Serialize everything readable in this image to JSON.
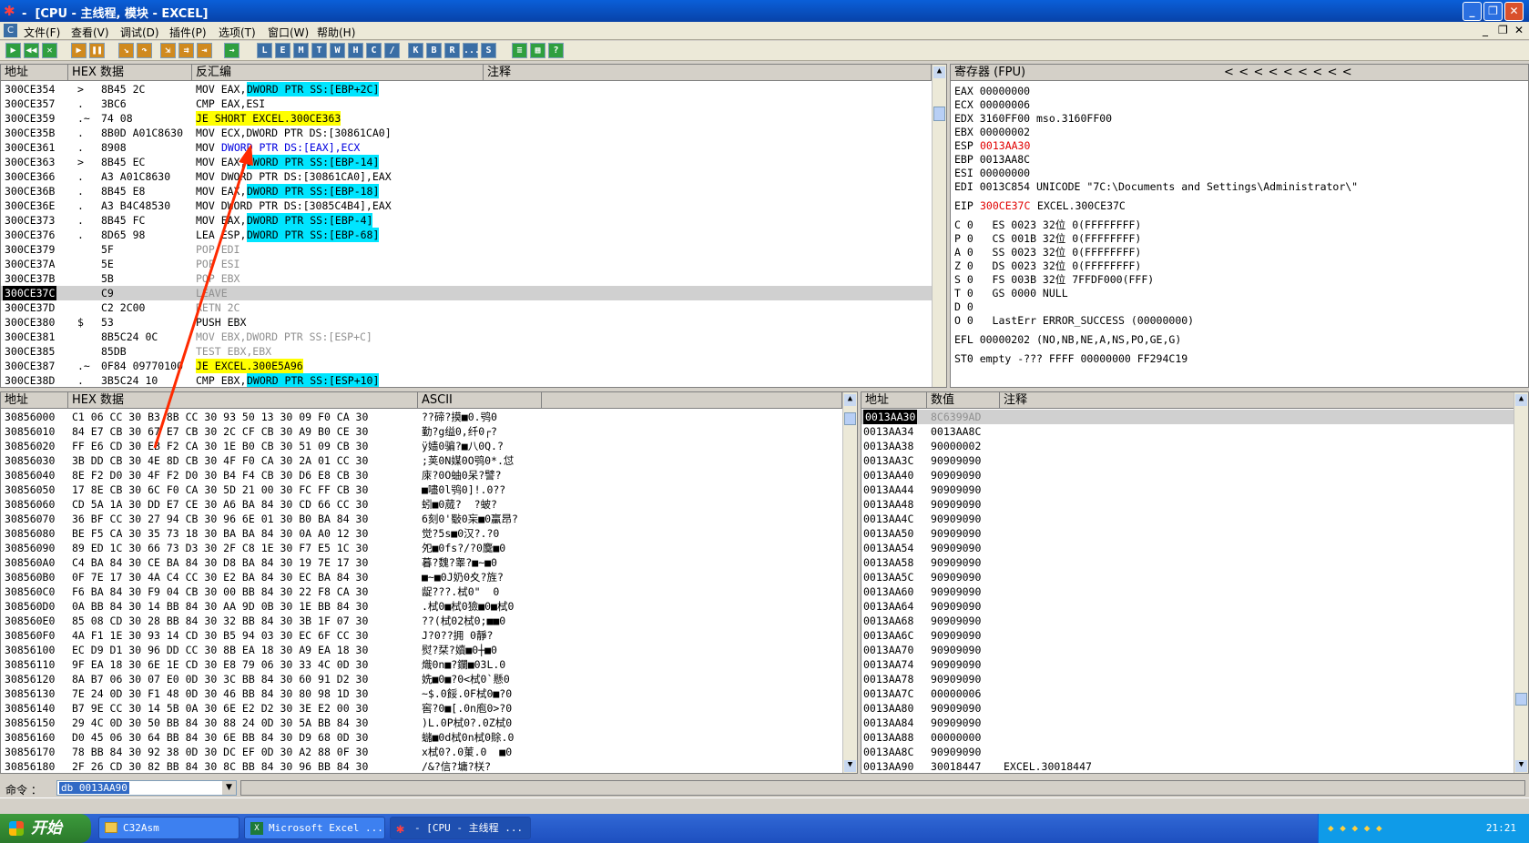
{
  "window": {
    "title": "-  [CPU - 主线程, 模块 - EXCEL]",
    "min": "_",
    "max": "❐",
    "close": "✕"
  },
  "menu": [
    "文件(F)",
    "查看(V)",
    "调试(D)",
    "插件(P)",
    "选项(T)",
    "窗口(W)",
    "帮助(H)"
  ],
  "toolbar_letters": [
    "L",
    "E",
    "M",
    "T",
    "W",
    "H",
    "C",
    "/",
    "K",
    "B",
    "R",
    "...",
    "S"
  ],
  "disasm": {
    "headers": [
      "地址",
      "HEX 数据",
      "反汇编",
      "注释"
    ],
    "rows": [
      {
        "addr": "300CE354",
        "mark": ">",
        "hex": "8B45 2C",
        "pre": "MOV EAX,",
        "hl": "DWORD PTR SS:[EBP+2C]",
        "post": "",
        "hlc": "c"
      },
      {
        "addr": "300CE357",
        "mark": ".",
        "hex": "3BC6",
        "pre": "CMP EAX,ESI",
        "hl": "",
        "post": ""
      },
      {
        "addr": "300CE359",
        "mark": ".~",
        "hex": "74 08",
        "pre": "",
        "hl": "JE SHORT EXCEL.300CE363",
        "post": "",
        "hlc": "y"
      },
      {
        "addr": "300CE35B",
        "mark": ".",
        "hex": "8B0D A01C8630",
        "pre": "MOV ECX,DWORD PTR DS:[30861CA0]",
        "hl": "",
        "post": ""
      },
      {
        "addr": "300CE361",
        "mark": ".",
        "hex": "8908",
        "pre": "MOV ",
        "hl": "",
        "post": "DWORD PTR DS:[EAX],ECX",
        "blue": "DWORD"
      },
      {
        "addr": "300CE363",
        "mark": ">",
        "hex": "8B45 EC",
        "pre": "MOV EAX,",
        "hl": "DWORD PTR SS:[EBP-14]",
        "post": "",
        "hlc": "c"
      },
      {
        "addr": "300CE366",
        "mark": ".",
        "hex": "A3 A01C8630",
        "pre": "MOV DWORD PTR DS:[30861CA0],EAX",
        "hl": "",
        "post": ""
      },
      {
        "addr": "300CE36B",
        "mark": ".",
        "hex": "8B45 E8",
        "pre": "MOV EAX,",
        "hl": "DWORD PTR SS:[EBP-18]",
        "post": "",
        "hlc": "c"
      },
      {
        "addr": "300CE36E",
        "mark": ".",
        "hex": "A3 B4C48530",
        "pre": "MOV DWORD PTR DS:[3085C4B4],EAX",
        "hl": "",
        "post": ""
      },
      {
        "addr": "300CE373",
        "mark": ".",
        "hex": "8B45 FC",
        "pre": "MOV EAX,",
        "hl": "DWORD PTR SS:[EBP-4]",
        "post": "",
        "hlc": "c"
      },
      {
        "addr": "300CE376",
        "mark": ".",
        "hex": "8D65 98",
        "pre": "LEA ESP,",
        "hl": "DWORD PTR SS:[EBP-68]",
        "post": "",
        "hlc": "c"
      },
      {
        "addr": "300CE379",
        "mark": "",
        "hex": "5F",
        "pre": "POP EDI",
        "hl": "",
        "post": "",
        "grey": true
      },
      {
        "addr": "300CE37A",
        "mark": "",
        "hex": "5E",
        "pre": "POP ESI",
        "hl": "",
        "post": "",
        "grey": true
      },
      {
        "addr": "300CE37B",
        "mark": "",
        "hex": "5B",
        "pre": "POP EBX",
        "hl": "",
        "post": "",
        "grey": true
      },
      {
        "addr": "300CE37C",
        "mark": "",
        "hex": "C9",
        "pre": "LEAVE",
        "hl": "",
        "post": "",
        "grey": true,
        "sel": true
      },
      {
        "addr": "300CE37D",
        "mark": "",
        "hex": "C2 2C00",
        "pre": "RETN 2C",
        "hl": "",
        "post": "",
        "grey": true
      },
      {
        "addr": "300CE380",
        "mark": "$",
        "hex": "53",
        "pre": "PUSH EBX",
        "hl": "",
        "post": "",
        "blue": "PUSH"
      },
      {
        "addr": "300CE381",
        "mark": "",
        "hex": "8B5C24 0C",
        "pre": "MOV EBX,DWORD PTR SS:[ESP+C]",
        "hl": "",
        "post": "",
        "grey": true
      },
      {
        "addr": "300CE385",
        "mark": "",
        "hex": "85DB",
        "pre": "TEST EBX,EBX",
        "hl": "",
        "post": "",
        "grey": true
      },
      {
        "addr": "300CE387",
        "mark": ".~",
        "hex": "0F84 09770100",
        "pre": "",
        "hl": "JE EXCEL.300E5A96",
        "post": "",
        "hlc": "y"
      },
      {
        "addr": "300CE38D",
        "mark": ".",
        "hex": "3B5C24 10",
        "pre": "CMP EBX,",
        "hl": "DWORD PTR SS:[ESP+10]",
        "post": "",
        "hlc": "c"
      }
    ]
  },
  "registers": {
    "header": "寄存器 (FPU)",
    "arrows": "<    <    <    <    <    <    <    <    <",
    "lines": [
      {
        "t": "EAX 00000000"
      },
      {
        "t": "ECX 00000006"
      },
      {
        "t": "EDX 3160FF00 mso.3160FF00"
      },
      {
        "t": "EBX 00000002"
      },
      {
        "t": "ESP ",
        "r": "0013AA30"
      },
      {
        "t": "EBP 0013AA8C"
      },
      {
        "t": "ESI 00000000"
      },
      {
        "t": "EDI 0013C854 UNICODE \"7C:\\Documents and Settings\\Administrator\\\""
      },
      {
        "t": "",
        "gap": true
      },
      {
        "t": "EIP ",
        "r": "300CE37C",
        "after": " EXCEL.300CE37C"
      },
      {
        "t": "",
        "gap": true
      },
      {
        "t": "C 0   ES 0023 32位 0(FFFFFFFF)"
      },
      {
        "t": "P 0   CS 001B 32位 0(FFFFFFFF)"
      },
      {
        "t": "A 0   SS 0023 32位 0(FFFFFFFF)"
      },
      {
        "t": "Z 0   DS 0023 32位 0(FFFFFFFF)"
      },
      {
        "t": "S 0   FS 003B 32位 7FFDF000(FFF)"
      },
      {
        "t": "T 0   GS 0000 NULL"
      },
      {
        "t": "D 0"
      },
      {
        "t": "O 0   LastErr ERROR_SUCCESS (00000000)"
      },
      {
        "t": "",
        "gap": true
      },
      {
        "t": "EFL 00000202 (NO,NB,NE,A,NS,PO,GE,G)"
      },
      {
        "t": "",
        "gap": true
      },
      {
        "t": "ST0 empty -??? FFFF 00000000 FF294C19"
      }
    ]
  },
  "dump": {
    "headers": [
      "地址",
      "HEX 数据",
      "ASCII"
    ],
    "rows": [
      [
        "30856000",
        "C1 06 CC 30 B3 8B CC 30 93 50 13 30 09 F0 CA 30",
        "??碲?摸■0.鸮0"
      ],
      [
        "30856010",
        "84 E7 CB 30 67 E7 CB 30 2C CF CB 30 A9 B0 CE 30",
        "勤?g缢0,纤0┌?"
      ],
      [
        "30856020",
        "FF E6 CD 30 EB F2 CA 30 1E B0 CB 30 51 09 CB 30",
        "ÿ嫱0骗?■八0Q.?"
      ],
      [
        "30856030",
        "3B DD CB 30 4E 8D CB 30 4F F0 CA 30 2A 01 CC 30",
        ";荚0N媒0O鸮0*.怤"
      ],
      [
        "30856040",
        "8E F2 D0 30 4F F2 D0 30 B4 F4 CB 30 D6 E8 CB 30",
        "庲?0O蚰0呆?譬?"
      ],
      [
        "30856050",
        "17 8E CB 30 6C F0 CA 30 5D 21 00 30 FC FF CB 30",
        "■嚍0l鸮0]!.0??"
      ],
      [
        "30856060",
        "CD 5A 1A 30 DD E7 CE 30 A6 BA 84 30 CD 66 CC 30",
        "蚓■0蒇?  ?蚾?"
      ],
      [
        "30856070",
        "36 BF CC 30 27 94 CB 30 96 6E 01 30 B0 BA 84 30",
        "6刻0'斀0杗■0臝昂?"
      ],
      [
        "30856080",
        "BE F5 CA 30 35 73 18 30 BA BA 84 30 0A A0 12 30",
        "觉?5s■0汉?.?0"
      ],
      [
        "30856090",
        "89 ED 1C 30 66 73 D3 30 2F C8 1E 30 F7 E5 1C 30",
        "夗■0fs?/?0麌■0"
      ],
      [
        "308560A0",
        "C4 BA 84 30 CE BA 84 30 D8 BA 84 30 19 7E 17 30",
        "暮?魏?睾?■~■0"
      ],
      [
        "308560B0",
        "0F 7E 17 30 4A C4 CC 30 E2 BA 84 30 EC BA 84 30",
        "■~■0J奶0夊?旌?"
      ],
      [
        "308560C0",
        "F6 BA 84 30 F9 04 CB 30 00 BB 84 30 22 F8 CA 30",
        "龊???.栻0\"  0"
      ],
      [
        "308560D0",
        "0A BB 84 30 14 BB 84 30 AA 9D 0B 30 1E BB 84 30",
        ".栻0■栻0獫■0■栻0"
      ],
      [
        "308560E0",
        "85 08 CD 30 28 BB 84 30 32 BB 84 30 3B 1F 07 30",
        "??(栻02栻0;■■0"
      ],
      [
        "308560F0",
        "4A F1 1E 30 93 14 CD 30 B5 94 03 30 EC 6F CC 30",
        "J?0??拥 0靜?"
      ],
      [
        "30856100",
        "EC D9 D1 30 96 DD CC 30 8B EA 18 30 A9 EA 18 30",
        "熨?栞?嬻■0┼■0"
      ],
      [
        "30856110",
        "9F EA 18 30 6E 1E CD 30 E8 79 06 30 33 4C 0D 30",
        "熾0n■?鑭■03L.0"
      ],
      [
        "30856120",
        "8A B7 06 30 07 E0 0D 30 3C BB 84 30 60 91 D2 30",
        "姺■0■?0<栻0`懸0"
      ],
      [
        "30856130",
        "7E 24 0D 30 F1 48 0D 30 46 BB 84 30 80 98 1D 30",
        "~$.0餒.0F栻0■?0"
      ],
      [
        "30856140",
        "B7 9E CC 30 14 5B 0A 30 6E E2 D2 30 3E E2 00 30",
        "窖?0■[.0n庖0>?0"
      ],
      [
        "30856150",
        "29 4C 0D 30 50 BB 84 30 88 24 0D 30 5A BB 84 30",
        ")L.0P栻0?.0Z栻0"
      ],
      [
        "30856160",
        "D0 45 06 30 64 BB 84 30 6E BB 84 30 D9 68 0D 30",
        "蠩■0d栻0n栻0賖.0"
      ],
      [
        "30856170",
        "78 BB 84 30 92 38 0D 30 DC EF 0D 30 A2 88 0F 30",
        "x栻0?.0菄.0  ■0"
      ],
      [
        "30856180",
        "2F 26 CD 30 82 BB 84 30 8C BB 84 30 96 BB 84 30",
        "/&?信?墉?栚?"
      ]
    ]
  },
  "stack": {
    "headers": [
      "地址",
      "数值",
      "注释"
    ],
    "rows": [
      [
        "0013AA30",
        "8C6399AD",
        ""
      ],
      [
        "0013AA34",
        "0013AA8C",
        ""
      ],
      [
        "0013AA38",
        "90000002",
        ""
      ],
      [
        "0013AA3C",
        "90909090",
        ""
      ],
      [
        "0013AA40",
        "90909090",
        ""
      ],
      [
        "0013AA44",
        "90909090",
        ""
      ],
      [
        "0013AA48",
        "90909090",
        ""
      ],
      [
        "0013AA4C",
        "90909090",
        ""
      ],
      [
        "0013AA50",
        "90909090",
        ""
      ],
      [
        "0013AA54",
        "90909090",
        ""
      ],
      [
        "0013AA58",
        "90909090",
        ""
      ],
      [
        "0013AA5C",
        "90909090",
        ""
      ],
      [
        "0013AA60",
        "90909090",
        ""
      ],
      [
        "0013AA64",
        "90909090",
        ""
      ],
      [
        "0013AA68",
        "90909090",
        ""
      ],
      [
        "0013AA6C",
        "90909090",
        ""
      ],
      [
        "0013AA70",
        "90909090",
        ""
      ],
      [
        "0013AA74",
        "90909090",
        ""
      ],
      [
        "0013AA78",
        "90909090",
        ""
      ],
      [
        "0013AA7C",
        "00000006",
        ""
      ],
      [
        "0013AA80",
        "90909090",
        ""
      ],
      [
        "0013AA84",
        "90909090",
        ""
      ],
      [
        "0013AA88",
        "00000000",
        ""
      ],
      [
        "0013AA8C",
        "90909090",
        ""
      ],
      [
        "0013AA90",
        "30018447",
        "EXCEL.30018447"
      ]
    ]
  },
  "command": {
    "label": "命令 ：",
    "value": "db 0013AA90"
  },
  "taskbar": {
    "start": "开始",
    "tasks": [
      "C32Asm",
      "Microsoft Excel ...",
      "- [CPU - 主线程 ..."
    ],
    "time": "21:21"
  },
  "colors": {
    "highlight_yellow": "#ffff00",
    "highlight_cyan": "#00e5ff",
    "selection": "#000000",
    "register_changed": "#e00000",
    "annotation_arrow": "#ff2a00"
  }
}
